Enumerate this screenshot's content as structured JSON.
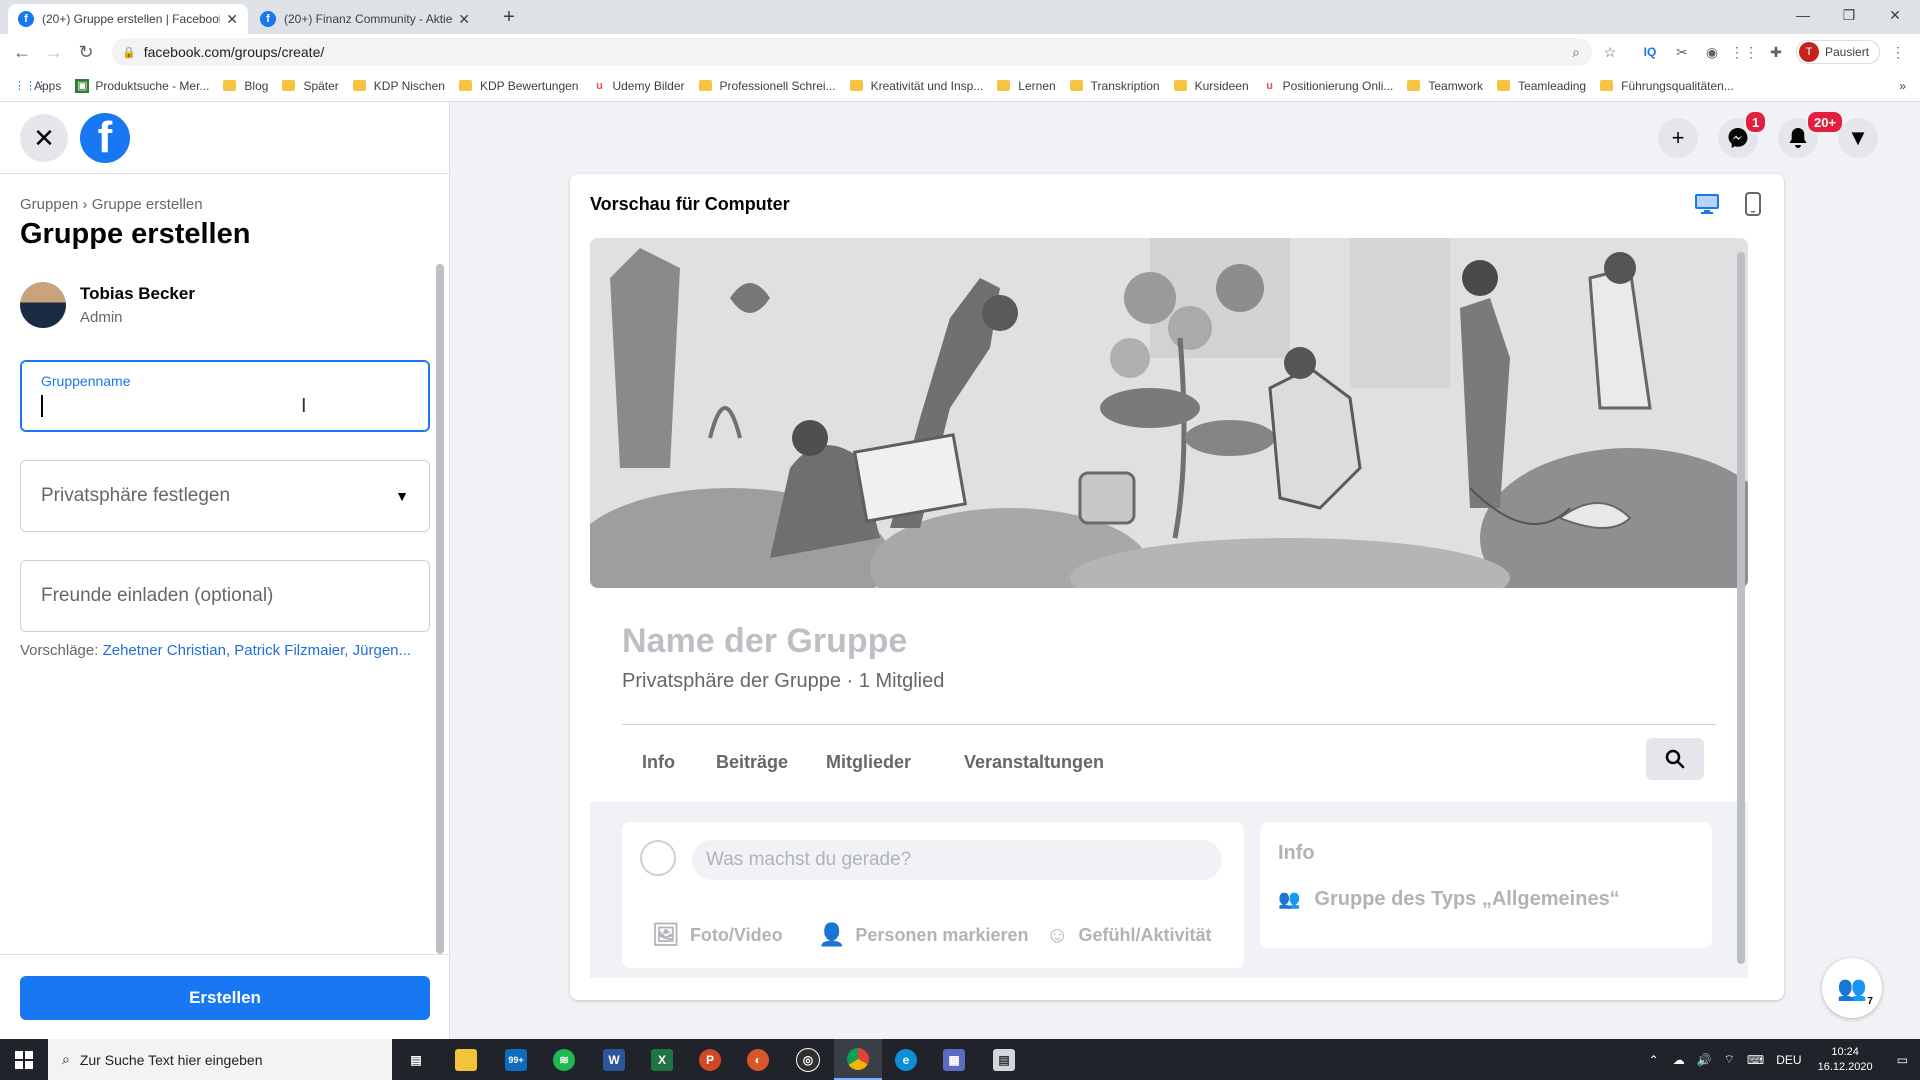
{
  "browser": {
    "tabs": [
      {
        "title": "(20+) Gruppe erstellen | Facebook",
        "active": true
      },
      {
        "title": "(20+) Finanz Community - Aktien",
        "active": false
      }
    ],
    "url": "facebook.com/groups/create/",
    "profile_initial": "T",
    "profile_label": "Pausiert",
    "bookmarks": [
      {
        "label": "Apps",
        "icon": "apps-grid-icon"
      },
      {
        "label": "Produktsuche - Mer...",
        "icon": "site-icon"
      },
      {
        "label": "Blog",
        "icon": "folder-icon"
      },
      {
        "label": "Später",
        "icon": "folder-icon"
      },
      {
        "label": "KDP Nischen",
        "icon": "folder-icon"
      },
      {
        "label": "KDP Bewertungen",
        "icon": "folder-icon"
      },
      {
        "label": "Udemy Bilder",
        "icon": "udemy-icon"
      },
      {
        "label": "Professionell Schrei...",
        "icon": "folder-icon"
      },
      {
        "label": "Kreativität und Insp...",
        "icon": "folder-icon"
      },
      {
        "label": "Lernen",
        "icon": "folder-icon"
      },
      {
        "label": "Transkription",
        "icon": "folder-icon"
      },
      {
        "label": "Kursideen",
        "icon": "folder-icon"
      },
      {
        "label": "Positionierung Onli...",
        "icon": "udemy-icon"
      },
      {
        "label": "Teamwork",
        "icon": "folder-icon"
      },
      {
        "label": "Teamleading",
        "icon": "folder-icon"
      },
      {
        "label": "Führungsqualitäten...",
        "icon": "folder-icon"
      }
    ]
  },
  "left_panel": {
    "breadcrumb": {
      "parent": "Gruppen",
      "separator": "›",
      "current": "Gruppe erstellen"
    },
    "title": "Gruppe erstellen",
    "user": {
      "name": "Tobias Becker",
      "role": "Admin"
    },
    "group_name_field": {
      "label": "Gruppenname",
      "value": ""
    },
    "privacy_select": {
      "placeholder": "Privatsphäre festlegen"
    },
    "invite_field": {
      "placeholder": "Freunde einladen (optional)"
    },
    "suggestions": {
      "label": "Vorschläge:",
      "names": "Zehetner Christian, Patrick Filzmaier, Jürgen..."
    },
    "create_button": "Erstellen"
  },
  "header_icons": {
    "messenger_badge": "1",
    "notifications_badge": "20+"
  },
  "preview": {
    "title": "Vorschau für Computer",
    "group_name": "Name der Gruppe",
    "group_meta": "Privatsphäre der Gruppe · 1 Mitglied",
    "tabs": [
      "Info",
      "Beiträge",
      "Mitglieder",
      "Veranstaltungen"
    ],
    "composer": {
      "placeholder": "Was machst du gerade?",
      "actions": [
        "Foto/Video",
        "Personen markieren",
        "Gefühl/Aktivität"
      ]
    },
    "info_card": {
      "title": "Info",
      "group_type": "Gruppe des Typs „Allgemeines“"
    }
  },
  "groups_fab_count": "7",
  "taskbar": {
    "search_placeholder": "Zur Suche Text hier eingeben",
    "mail_badge": "99+",
    "language": "DEU",
    "time": "10:24",
    "date": "16.12.2020"
  },
  "colors": {
    "facebook_blue": "#1877f2",
    "badge_red": "#e41e3f",
    "link_blue": "#216fdb"
  }
}
